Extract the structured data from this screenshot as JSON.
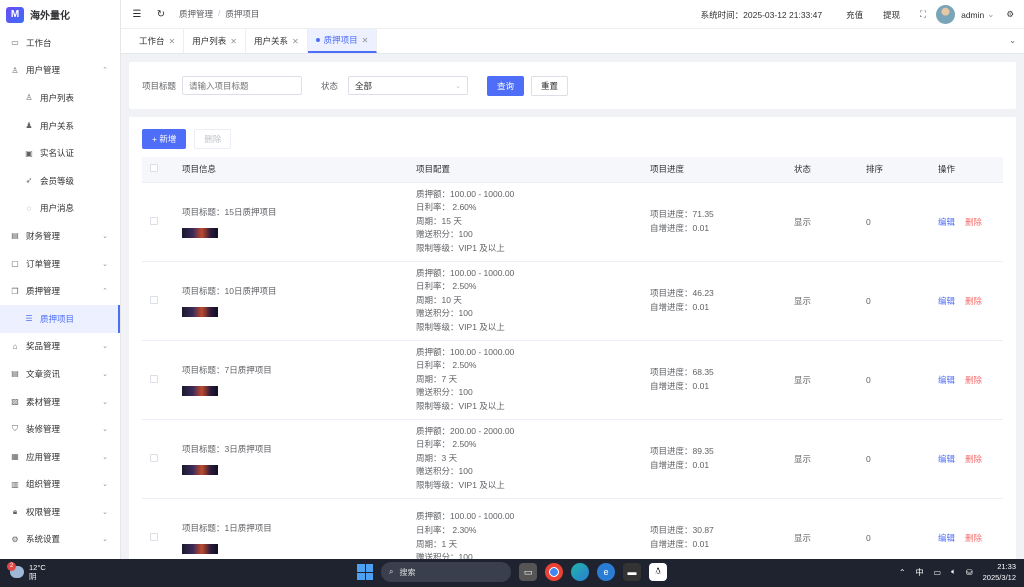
{
  "app": {
    "name": "海外量化",
    "logo_letter": "M"
  },
  "sidebar": {
    "items": [
      {
        "label": "工作台",
        "icon": "monitor-icon",
        "glyph": "▭",
        "chevron": "",
        "sub": false,
        "active": false
      },
      {
        "label": "用户管理",
        "icon": "user-icon",
        "glyph": "♙",
        "chevron": "⌃",
        "sub": false,
        "active": false
      },
      {
        "label": "用户列表",
        "icon": "user-icon",
        "glyph": "♙",
        "chevron": "",
        "sub": true,
        "active": false
      },
      {
        "label": "用户关系",
        "icon": "users-icon",
        "glyph": "♟",
        "chevron": "",
        "sub": true,
        "active": false
      },
      {
        "label": "实名认证",
        "icon": "id-card-icon",
        "glyph": "▣",
        "chevron": "",
        "sub": true,
        "active": false
      },
      {
        "label": "会员等级",
        "icon": "rocket-icon",
        "glyph": "➶",
        "chevron": "",
        "sub": true,
        "active": false
      },
      {
        "label": "用户消息",
        "icon": "chat-icon",
        "glyph": "◌",
        "chevron": "",
        "sub": true,
        "active": false
      },
      {
        "label": "财务管理",
        "icon": "chart-icon",
        "glyph": "▤",
        "chevron": "⌄",
        "sub": false,
        "active": false
      },
      {
        "label": "订单管理",
        "icon": "order-icon",
        "glyph": "▢",
        "chevron": "⌄",
        "sub": false,
        "active": false
      },
      {
        "label": "质押管理",
        "icon": "pledge-icon",
        "glyph": "❐",
        "chevron": "⌃",
        "sub": false,
        "active": false
      },
      {
        "label": "质押项目",
        "icon": "list-icon",
        "glyph": "☰",
        "chevron": "",
        "sub": true,
        "active": true
      },
      {
        "label": "奖品管理",
        "icon": "gift-icon",
        "glyph": "⌂",
        "chevron": "⌄",
        "sub": false,
        "active": false
      },
      {
        "label": "文章资讯",
        "icon": "article-icon",
        "glyph": "▤",
        "chevron": "⌄",
        "sub": false,
        "active": false
      },
      {
        "label": "素材管理",
        "icon": "image-icon",
        "glyph": "▨",
        "chevron": "⌄",
        "sub": false,
        "active": false
      },
      {
        "label": "装修管理",
        "icon": "decorate-icon",
        "glyph": "⛉",
        "chevron": "⌄",
        "sub": false,
        "active": false
      },
      {
        "label": "应用管理",
        "icon": "app-icon",
        "glyph": "▦",
        "chevron": "⌄",
        "sub": false,
        "active": false
      },
      {
        "label": "组织管理",
        "icon": "org-icon",
        "glyph": "▥",
        "chevron": "⌄",
        "sub": false,
        "active": false
      },
      {
        "label": "权限管理",
        "icon": "lock-icon",
        "glyph": "🔒︎",
        "chevron": "⌄",
        "sub": false,
        "active": false
      },
      {
        "label": "系统设置",
        "icon": "gear-icon",
        "glyph": "⚙",
        "chevron": "⌄",
        "sub": false,
        "active": false
      }
    ]
  },
  "header": {
    "breadcrumb": [
      "质押管理",
      "质押项目"
    ],
    "system_time": "系统时间：2025-03-12 21:33:47",
    "recharge": "充值",
    "withdraw": "提现",
    "username": "admin"
  },
  "tabs": [
    {
      "label": "工作台",
      "active": false
    },
    {
      "label": "用户列表",
      "active": false
    },
    {
      "label": "用户关系",
      "active": false
    },
    {
      "label": "质押项目",
      "active": true
    }
  ],
  "filter": {
    "title_label": "项目标题",
    "title_placeholder": "请输入项目标题",
    "status_label": "状态",
    "status_value": "全部",
    "query": "查询",
    "reset": "重置"
  },
  "toolbar": {
    "add": "+ 新增",
    "delete": "删除"
  },
  "table": {
    "headers": [
      "项目信息",
      "项目配置",
      "项目进度",
      "状态",
      "排序",
      "操作"
    ],
    "edit_label": "编辑",
    "delete_label": "删除",
    "rows": [
      {
        "title": "项目标题：15日质押项目",
        "cfg": [
          "质押额：100.00 - 1000.00",
          "日利率：  2.60%",
          "周期：15 天",
          "赠送积分：100",
          "限制等级：VIP1 及以上"
        ],
        "progress": "项目进度：71.35",
        "auto": "自增进度：0.01",
        "status": "显示",
        "sort": "0"
      },
      {
        "title": "项目标题：10日质押项目",
        "cfg": [
          "质押额：100.00 - 1000.00",
          "日利率：  2.50%",
          "周期：10 天",
          "赠送积分：100",
          "限制等级：VIP1 及以上"
        ],
        "progress": "项目进度：46.23",
        "auto": "自增进度：0.01",
        "status": "显示",
        "sort": "0"
      },
      {
        "title": "项目标题：7日质押项目",
        "cfg": [
          "质押额：100.00 - 1000.00",
          "日利率：  2.50%",
          "周期：7 天",
          "赠送积分：100",
          "限制等级：VIP1 及以上"
        ],
        "progress": "项目进度：68.35",
        "auto": "自增进度：0.01",
        "status": "显示",
        "sort": "0"
      },
      {
        "title": "项目标题：3日质押项目",
        "cfg": [
          "质押额：200.00 - 2000.00",
          "日利率：  2.50%",
          "周期：3 天",
          "赠送积分：100",
          "限制等级：VIP1 及以上"
        ],
        "progress": "项目进度：89.35",
        "auto": "自增进度：0.01",
        "status": "显示",
        "sort": "0"
      },
      {
        "title": "项目标题：1日质押项目",
        "cfg": [
          "质押额：100.00 - 1000.00",
          "日利率：  2.30%",
          "周期：1 天",
          "赠送积分：100",
          ""
        ],
        "progress": "项目进度：30.87",
        "auto": "自增进度：0.01",
        "status": "显示",
        "sort": "0"
      }
    ]
  },
  "taskbar": {
    "temp": "12°C",
    "weather": "阴",
    "badge": "2",
    "search": "搜索",
    "ime": "中",
    "time": "21:33",
    "date": "2025/3/12"
  }
}
